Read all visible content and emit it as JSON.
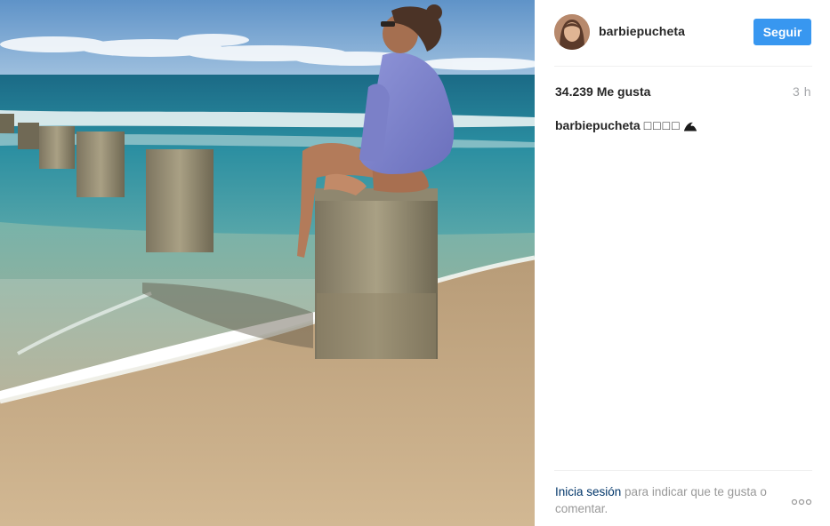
{
  "post": {
    "username": "barbiepucheta",
    "follow_label": "Seguir",
    "likes_text": "34.239 Me gusta",
    "time_ago": "3 h",
    "caption_user": "barbiepucheta",
    "caption_text": "□□□□",
    "caption_icon": "wave-icon"
  },
  "footer": {
    "login_link": "Inicia sesión",
    "login_rest": " para indicar que te gusta o comentar."
  },
  "colors": {
    "follow_button": "#3897f0",
    "link": "#003569",
    "muted_text": "#999999",
    "time_text": "#a5a7aa"
  }
}
